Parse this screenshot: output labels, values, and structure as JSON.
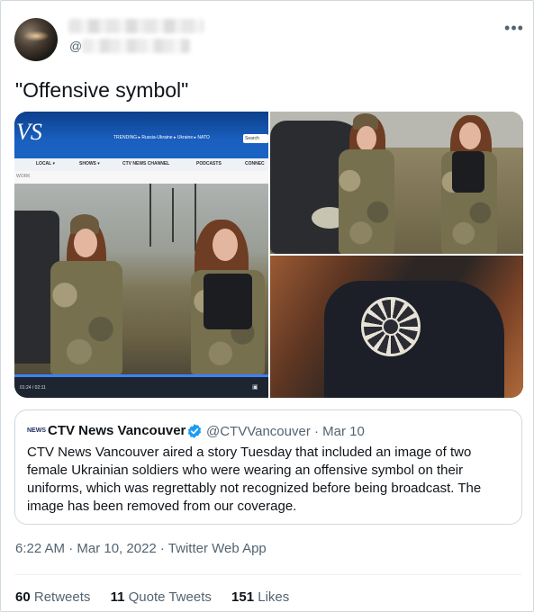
{
  "author": {
    "handle_prefix": "@"
  },
  "tweet": {
    "text": "\"Offensive symbol\"",
    "more_icon": "more-horizontal-icon"
  },
  "media": {
    "broadcast": {
      "logo": "VS",
      "trending": "TRENDING ▸ Russia-Ukraine ▸ Ukraine ▸ NATO",
      "search": "Search",
      "nav": [
        "LOCAL ▾",
        "SHOWS ▾",
        "CTV NEWS CHANNEL",
        "PODCASTS",
        "CONNEC"
      ],
      "sub": "WORK",
      "time": "01:24 / 02:11"
    }
  },
  "quote": {
    "logo": "NEWS",
    "name": "CTV News Vancouver",
    "handle": "@CTVVancouver · Mar 10",
    "body": "CTV News Vancouver aired a story Tuesday that included an image of two female Ukrainian soldiers who were wearing an offensive symbol on their uniforms, which was regrettably not recognized before being broadcast. The image has been removed from our coverage.",
    "verified_color": "#1d9bf0"
  },
  "meta": {
    "timestamp": "6:22 AM · Mar 10, 2022 · Twitter Web App"
  },
  "stats": {
    "retweets_count": "60",
    "retweets_label": "Retweets",
    "quotes_count": "11",
    "quotes_label": "Quote Tweets",
    "likes_count": "151",
    "likes_label": "Likes"
  }
}
